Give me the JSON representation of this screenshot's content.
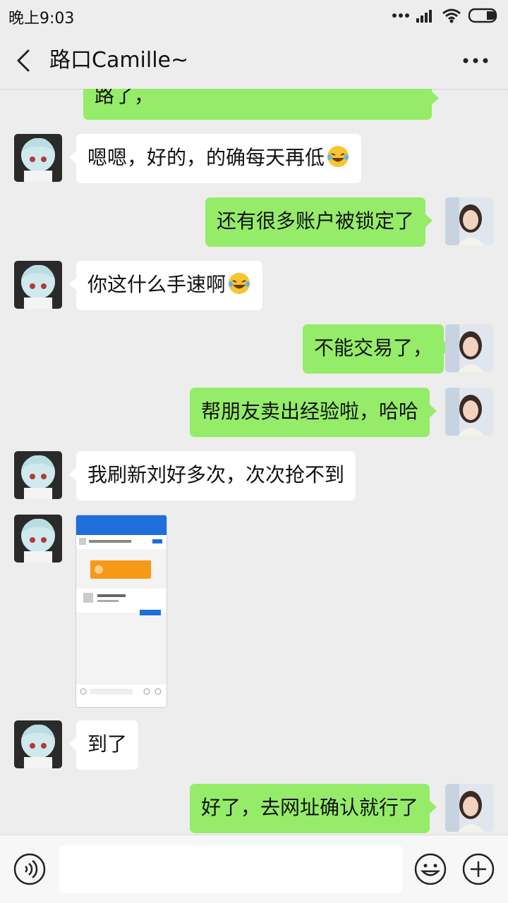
{
  "status_bar": {
    "time": "晚上9:03"
  },
  "header": {
    "title": "路口Camille~"
  },
  "messages": [
    {
      "side": "out",
      "text": "路了，"
    },
    {
      "side": "in",
      "text": "嗯嗯，好的，的确每天再低",
      "emoji": "laughing-tears"
    },
    {
      "side": "out",
      "text": "还有很多账户被锁定了"
    },
    {
      "side": "in",
      "text": "你这什么手速啊",
      "emoji": "laughing-tears"
    },
    {
      "side": "out",
      "text": "不能交易了，"
    },
    {
      "side": "out",
      "text": "帮朋友卖出经验啦，哈哈"
    },
    {
      "side": "in",
      "text": "我刷新刘好多次，次次抢不到"
    },
    {
      "side": "in",
      "type": "image",
      "description": "screenshot"
    },
    {
      "side": "in",
      "text": "到了"
    },
    {
      "side": "out",
      "text": "好了，去网址确认就行了"
    }
  ],
  "input": {
    "value": ""
  },
  "colors": {
    "outgoing_bubble": "#95ec69",
    "incoming_bubble": "#ffffff",
    "background": "#ededed"
  }
}
